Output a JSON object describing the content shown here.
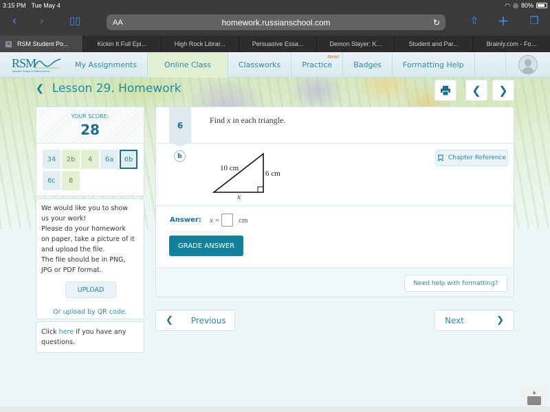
{
  "status_bar": {
    "time": "3:15 PM",
    "date": "Tue May 4",
    "battery": "80%"
  },
  "browser": {
    "url": "homework.russianschool.com",
    "text_size_label": "AA",
    "tabs": [
      {
        "label": "RSM Student Po...",
        "active": true
      },
      {
        "label": "Kickin It Full Epi..."
      },
      {
        "label": "High Rock Librar..."
      },
      {
        "label": "Persuasive Essa..."
      },
      {
        "label": "Demon Slayer: K..."
      },
      {
        "label": "Student and Par..."
      },
      {
        "label": "Brainly.com - Fo..."
      }
    ]
  },
  "site_nav": {
    "logo_text": "RSM",
    "logo_subtitle": "Russian School of Mathematics",
    "items": [
      {
        "label": "My Assignments"
      },
      {
        "label": "Online Class",
        "active": true
      },
      {
        "label": "Classworks"
      },
      {
        "label": "Practice",
        "badge": "New!"
      },
      {
        "label": "Badges"
      },
      {
        "label": "Formatting Help"
      }
    ]
  },
  "lesson": {
    "title": "Lesson 29. Homework"
  },
  "score": {
    "label": "YOUR SCORE:",
    "value": "28",
    "questions": [
      {
        "label": "34",
        "state": "default"
      },
      {
        "label": "2b",
        "state": "green"
      },
      {
        "label": "4",
        "state": "green"
      },
      {
        "label": "6a",
        "state": "default"
      },
      {
        "label": "6b",
        "state": "current"
      },
      {
        "label": "6c",
        "state": "default"
      },
      {
        "label": "8",
        "state": "green"
      }
    ]
  },
  "upload": {
    "text": "We would like you to show us your work! Please do your homework on paper, take a picture of it and upload the file. The file should be in PNG, JPG or PDF format.",
    "lines": [
      "We would like you to show",
      "us your work!",
      "Please do your homework",
      "on paper, take a picture of it",
      "and upload the file.",
      "The file should be in PNG,",
      "JPG or PDF format."
    ],
    "button": "UPLOAD",
    "qr_link": "Or upload by QR code."
  },
  "help": {
    "prefix": "Click ",
    "link": "here",
    "suffix": " if you have any questions."
  },
  "problem": {
    "number": "6",
    "prompt_pre": "Find ",
    "prompt_var": "x",
    "prompt_post": " in each triangle.",
    "part": "b",
    "triangle": {
      "hypotenuse": "10 cm",
      "leg": "6 cm",
      "base": "x"
    },
    "chapter_reference": "Chapter Reference",
    "answer_label": "Answer:",
    "answer_var": "x",
    "answer_eq": "=",
    "answer_value": "",
    "answer_unit": "cm",
    "grade_button": "GRADE ANSWER",
    "formatting_help": "Need help with formatting?"
  },
  "pager": {
    "previous": "Previous",
    "next": "Next"
  }
}
